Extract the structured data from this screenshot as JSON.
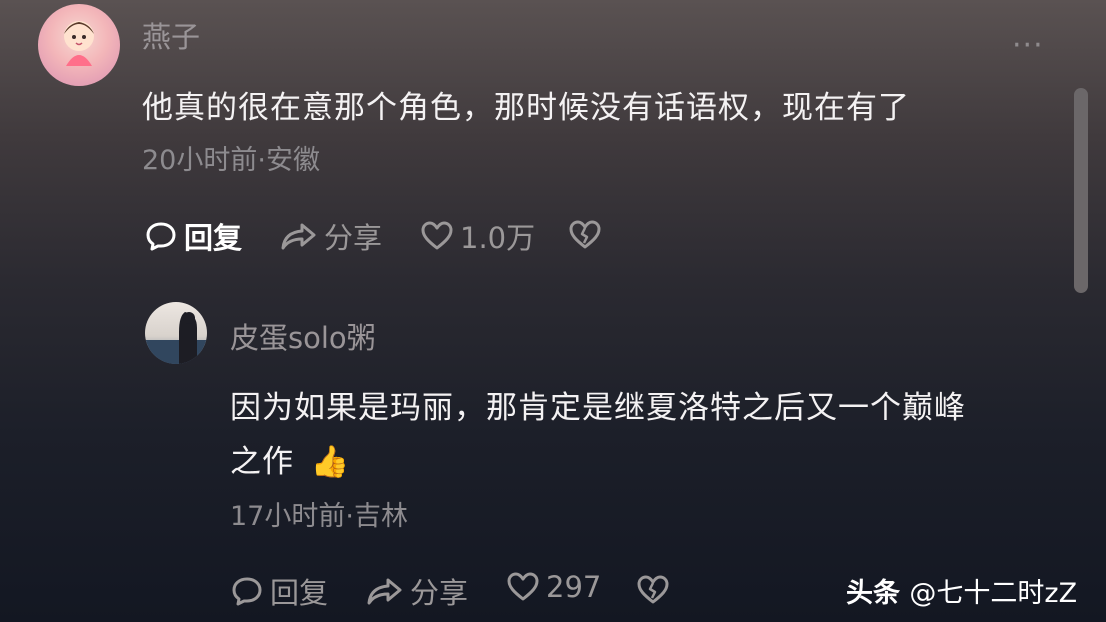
{
  "comment1": {
    "username": "燕子",
    "text": "他真的很在意那个角色，那时候没有话语权，现在有了",
    "meta": "20小时前·安徽",
    "reply_label": "回复",
    "share_label": "分享",
    "like_count": "1.0万",
    "more_label": "···"
  },
  "comment2": {
    "username": "皮蛋solo粥",
    "text_line1": "因为如果是玛丽，那肯定是继夏洛特之后又一个巅峰",
    "text_line2": "之作",
    "emoji": "👍",
    "meta": "17小时前·吉林",
    "reply_label": "回复",
    "share_label": "分享",
    "like_count": "297"
  },
  "watermark": {
    "brand": "头条",
    "handle": "@七十二时zZ"
  }
}
